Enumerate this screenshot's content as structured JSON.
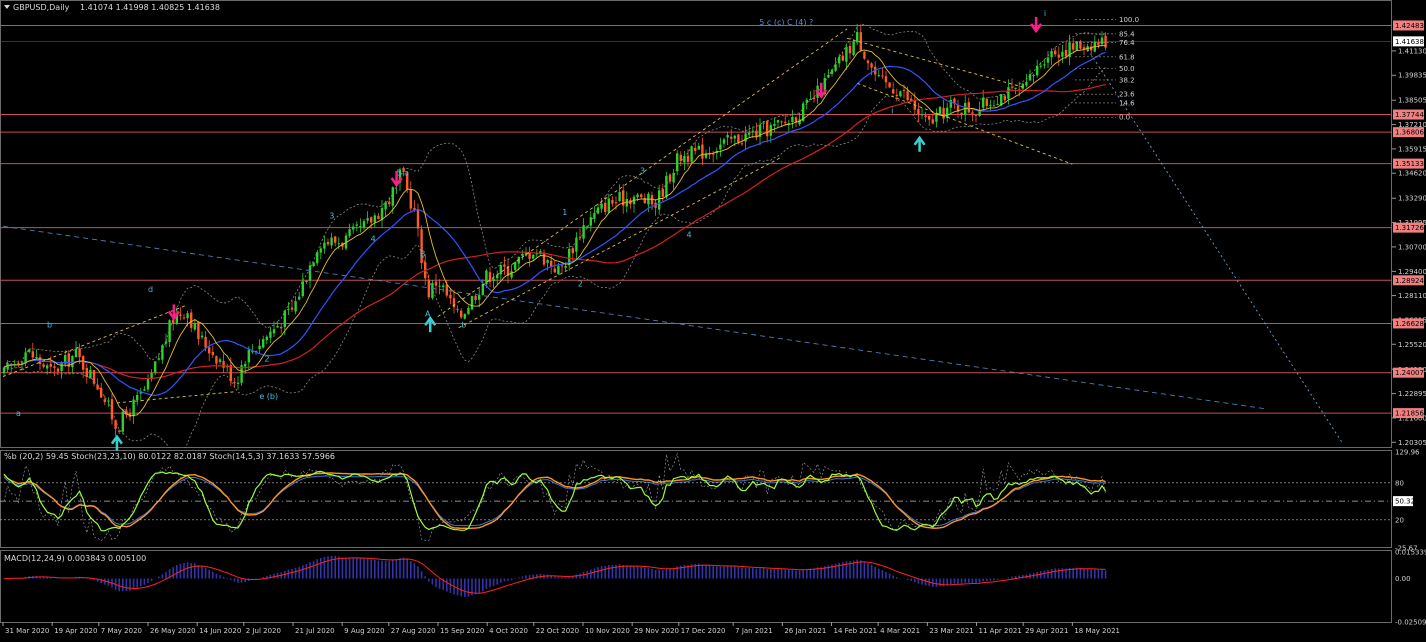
{
  "header": {
    "symbol": "GBPUSD,Daily",
    "ohlc": "1.41074 1.41998 1.40825 1.41638"
  },
  "colors": {
    "background": "#000000",
    "bull_candle": "#2bd12b",
    "bear_candle": "#ff5a2a",
    "ma_fast": "#e6c020",
    "ma_mid": "#2f55ff",
    "ma_slow": "#d42020",
    "level_line": "#c85050",
    "level_label_bg": "#f08080",
    "stoch_main": "#99ff33",
    "stoch_orange": "#ff9420",
    "macd_hist": "#3333aa",
    "macd_signal": "#ff2020",
    "grid_divider": "#9a9a9a",
    "wave_label": "#40c0e0",
    "arrow_down": "#ff1b8d",
    "arrow_up": "#3ad0d0"
  },
  "price_axis": {
    "ticks": [
      "1.41130",
      "1.39835",
      "1.38505",
      "1.37210",
      "1.35915",
      "1.34620",
      "1.33290",
      "1.31995",
      "1.30700",
      "1.29400",
      "1.28110",
      "1.26815",
      "1.25520",
      "1.24190",
      "1.22895",
      "1.21600",
      "1.20305"
    ],
    "current_price": "1.41638"
  },
  "levels": [
    {
      "value": "1.42483"
    },
    {
      "value": "1.37744"
    },
    {
      "value": "1.36806"
    },
    {
      "value": "1.35133"
    },
    {
      "value": "1.31726"
    },
    {
      "value": "1.28924"
    },
    {
      "value": "1.26628"
    },
    {
      "value": "1.24007"
    },
    {
      "value": "1.21856"
    }
  ],
  "fibo_labels": [
    "100.0",
    "85.4",
    "76.4",
    "61.8",
    "50.0",
    "38.2",
    "23.6",
    "14.6",
    "0.0"
  ],
  "date_axis": [
    "31 Mar 2020",
    "19 Apr 2020",
    "7 May 2020",
    "26 May 2020",
    "14 Jun 2020",
    "2 Jul 2020",
    "21 Jul 2020",
    "9 Aug 2020",
    "27 Aug 2020",
    "15 Sep 2020",
    "4 Oct 2020",
    "22 Oct 2020",
    "10 Nov 2020",
    "29 Nov 2020",
    "17 Dec 2020",
    "7 Jan 2021",
    "26 Jan 2021",
    "14 Feb 2021",
    "4 Mar 2021",
    "23 Mar 2021",
    "11 Apr 2021",
    "29 Apr 2021",
    "18 May 2021"
  ],
  "wave_labels": [
    {
      "text": "5 c (c) C (4) ?"
    },
    {
      "text": "5 a"
    },
    {
      "text": "3"
    },
    {
      "text": "4"
    },
    {
      "text": "B"
    },
    {
      "text": "A"
    },
    {
      "text": "b"
    },
    {
      "text": "1"
    },
    {
      "text": "2"
    },
    {
      "text": "3"
    },
    {
      "text": "4"
    },
    {
      "text": "d"
    },
    {
      "text": "b"
    },
    {
      "text": "c"
    },
    {
      "text": "a"
    },
    {
      "text": "e (b)"
    },
    {
      "text": "2"
    },
    {
      "text": "i"
    },
    {
      "text": "i"
    }
  ],
  "stoch_panel": {
    "title": "%b (20,2) 59.45  Stoch(23,23,10) 80.0122 82.0187  Stoch(14,5,3) 37.1633 57.5966",
    "axis": [
      "129.96",
      "80",
      "50.32",
      "20",
      "-25.67"
    ]
  },
  "macd_panel": {
    "title": "MACD(12,24,9) 0.003843 0.005100",
    "axis": [
      "0.015339",
      "0.00",
      "-0.025093"
    ]
  },
  "chart_data": {
    "type": "candlestick",
    "title": "GBPUSD,Daily",
    "ylim": [
      1.2,
      1.432
    ],
    "x_range": [
      "31 Mar 2020",
      "31 May 2021"
    ],
    "path_points": [
      [
        "31 Mar 2020",
        1.239
      ],
      [
        "9 Apr 2020",
        1.252
      ],
      [
        "19 Apr 2020",
        1.24
      ],
      [
        "28 Apr 2020",
        1.25
      ],
      [
        "7 May 2020",
        1.233
      ],
      [
        "14 May 2020",
        1.211
      ],
      [
        "26 May 2020",
        1.233
      ],
      [
        "5 Jun 2020",
        1.27
      ],
      [
        "10 Jun 2020",
        1.274
      ],
      [
        "14 Jun 2020",
        1.26
      ],
      [
        "24 Jun 2020",
        1.245
      ],
      [
        "29 Jun 2020",
        1.235
      ],
      [
        "2 Jul 2020",
        1.248
      ],
      [
        "11 Jul 2020",
        1.26
      ],
      [
        "21 Jul 2020",
        1.274
      ],
      [
        "31 Jul 2020",
        1.31
      ],
      [
        "9 Aug 2020",
        1.31
      ],
      [
        "18 Aug 2020",
        1.318
      ],
      [
        "27 Aug 2020",
        1.332
      ],
      [
        "1 Sep 2020",
        1.346
      ],
      [
        "6 Sep 2020",
        1.325
      ],
      [
        "11 Sep 2020",
        1.282
      ],
      [
        "15 Sep 2020",
        1.29
      ],
      [
        "23 Sep 2020",
        1.269
      ],
      [
        "4 Oct 2020",
        1.292
      ],
      [
        "13 Oct 2020",
        1.296
      ],
      [
        "22 Oct 2020",
        1.306
      ],
      [
        "1 Nov 2020",
        1.294
      ],
      [
        "10 Nov 2020",
        1.318
      ],
      [
        "19 Nov 2020",
        1.33
      ],
      [
        "29 Nov 2020",
        1.334
      ],
      [
        "8 Dec 2020",
        1.33
      ],
      [
        "17 Dec 2020",
        1.355
      ],
      [
        "27 Dec 2020",
        1.358
      ],
      [
        "7 Jan 2021",
        1.364
      ],
      [
        "16 Jan 2021",
        1.368
      ],
      [
        "26 Jan 2021",
        1.372
      ],
      [
        "5 Feb 2021",
        1.382
      ],
      [
        "14 Feb 2021",
        1.399
      ],
      [
        "24 Feb 2021",
        1.419
      ],
      [
        "4 Mar 2021",
        1.395
      ],
      [
        "13 Mar 2021",
        1.39
      ],
      [
        "23 Mar 2021",
        1.372
      ],
      [
        "1 Apr 2021",
        1.382
      ],
      [
        "11 Apr 2021",
        1.38
      ],
      [
        "20 Apr 2021",
        1.388
      ],
      [
        "29 Apr 2021",
        1.39
      ],
      [
        "8 May 2021",
        1.41
      ],
      [
        "18 May 2021",
        1.413
      ],
      [
        "24 May 2021",
        1.415
      ],
      [
        "31 May 2021",
        1.4164
      ]
    ],
    "indicators": [
      "MA fast",
      "MA mid",
      "MA slow",
      "%b (20,2)",
      "Stoch(23,23,10)",
      "Stoch(14,5,3)",
      "MACD(12,24,9)"
    ]
  }
}
